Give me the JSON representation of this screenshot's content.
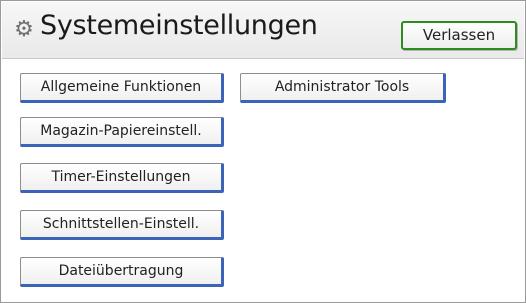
{
  "header": {
    "title": "Systemeinstellungen",
    "title_icon": "gear-icon",
    "exit_label": "Verlassen",
    "exit_border_color": "#2f8a1f"
  },
  "menu": {
    "buttons": [
      {
        "label": "Allgemeine Funktionen"
      },
      {
        "label": "Administrator Tools"
      },
      {
        "label": "Magazin-Papiereinstell."
      },
      {
        "label": "Timer-Einstellungen"
      },
      {
        "label": "Schnittstellen-Einstell."
      },
      {
        "label": "Dateiübertragung"
      }
    ],
    "accent_color": "#3b63b8"
  }
}
